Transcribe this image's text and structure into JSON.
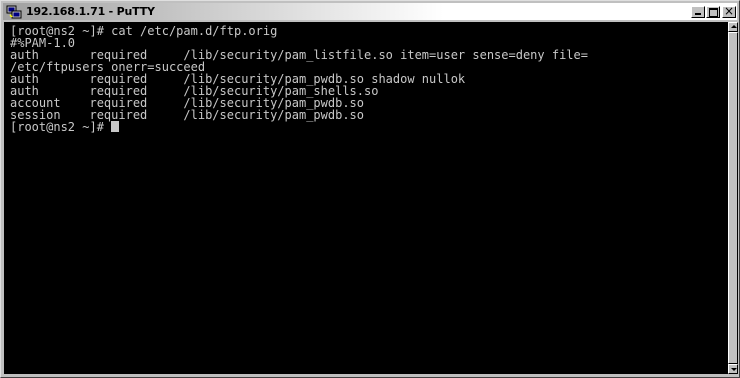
{
  "window": {
    "title": "192.168.1.71 - PuTTY",
    "icon": "putty-computer-icon",
    "buttons": [
      "minimize",
      "maximize",
      "close"
    ]
  },
  "terminal": {
    "lines": [
      "[root@ns2 ~]# cat /etc/pam.d/ftp.orig",
      "#%PAM-1.0",
      "auth       required     /lib/security/pam_listfile.so item=user sense=deny file=",
      "/etc/ftpusers onerr=succeed",
      "auth       required     /lib/security/pam_pwdb.so shadow nullok",
      "auth       required     /lib/security/pam_shells.so",
      "account    required     /lib/security/pam_pwdb.so",
      "session    required     /lib/security/pam_pwdb.so"
    ],
    "prompt": "[root@ns2 ~]# ",
    "colors": {
      "background": "#000000",
      "foreground": "#c8c8c8"
    }
  },
  "scrollbar": {
    "position": 1.0,
    "visible_fraction": 1.0
  }
}
